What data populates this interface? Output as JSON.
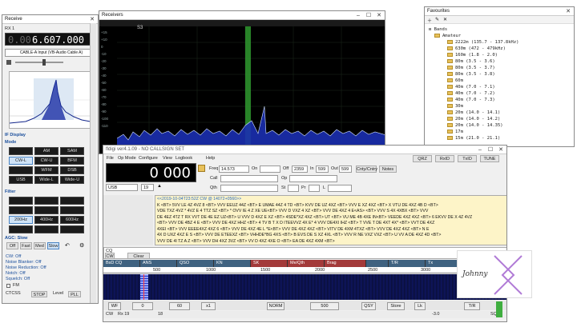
{
  "receive": {
    "title": "Receive",
    "rx_label": "RX 1",
    "freq_prefix": "0.00",
    "freq_main": "6.607.000",
    "audio_input": "CABLE-A Input (VB-Audio Cable A)",
    "display_label": "IF Display",
    "mode_label": "Mode",
    "modes": [
      "",
      "AM",
      "SAM",
      "CW-L",
      "CW-U",
      "BFM",
      "",
      "WFM",
      "DSB",
      "USB",
      "Wide-L",
      "Wide-U"
    ],
    "filter_label": "Filter",
    "filters": [
      "",
      "",
      "",
      "",
      "",
      "",
      "200Hz",
      "400Hz",
      "600Hz",
      "",
      "",
      ""
    ],
    "agc_label": "AGC: Slow",
    "agc_buttons": [
      "Off",
      "Fast",
      "Med",
      "Slow"
    ],
    "options": [
      "CW: Off",
      "Noise Blanker: Off",
      "Noise Reduction: Off",
      "Notch: Off",
      "Squelch: Off"
    ],
    "fm_label": "FM",
    "ctcss_label": "CTCSS",
    "level_label": "Level",
    "stop_label": "STOP",
    "pll_label": "PLL"
  },
  "receivers": {
    "title": "Receivers",
    "channel": "S3",
    "db_ticks": [
      "+15",
      "+10",
      "0",
      "-10",
      "-20",
      "-30",
      "-40",
      "-50",
      "-60",
      "-70",
      "-80",
      "-90",
      "-100",
      "-110"
    ]
  },
  "favourites": {
    "title": "Favourites",
    "root": "Bands",
    "group": "Amateur",
    "items": [
      "2222m (135.7 - 137.8kHz)",
      "630m (472 - 479kHz)",
      "160m (1.8 - 2.0)",
      "80m (3.5 - 3.6)",
      "80m (3.5 - 3.7)",
      "80m (3.5 - 3.8)",
      "60m",
      "40m (7.0 - 7.1)",
      "40m (7.0 - 7.2)",
      "40m (7.0 - 7.3)",
      "30m",
      "20m (14.0 - 14.1)",
      "20m (14.0 - 14.2)",
      "20m (14.0 - 14.35)",
      "17m",
      "15m (21.0 - 21.1)"
    ]
  },
  "hdsdr": {
    "title": "fldigi ver4.1.09 - NO CALLSIGN SET",
    "menu": [
      "File",
      "Op Mode",
      "Configure",
      "View",
      "Logbook",
      "",
      "",
      "Help"
    ],
    "freq_display": "0 000",
    "freq_label": "Freq",
    "freq_value": "14.573",
    "on_label": "On",
    "off_label": "Off",
    "off_value": "2359",
    "in_label": "In",
    "in_value": "599",
    "out_label": "Out",
    "out_value": "599",
    "cnty_label": "Cnty/Cntry",
    "notes_label": "Notes",
    "call_label": "Call",
    "qth_label": "Qth",
    "op_label": "Op",
    "st_label": "St",
    "pr_label": "Pr",
    "loc_label": "L",
    "mode_value": "USB",
    "bw_value": "19",
    "right_buttons": [
      "QRZ",
      "RxID",
      "TxID",
      "TUNE"
    ],
    "rx_header": "<<2019-10-04T23:52Z CW @ 14072+0560>>",
    "rx_lines": [
      "K <BT> 5VV LE 4Z 4VZ 8 <BT> VVV EEUZ 44Z <BT> E UMAE 44Z 4 TD <BT> KVV DE UZ 4XZ <BT> VVV E XZ 4XZ <BT> X VTU DE 4XZ 4B D <BT>",
      "VDE TXZ 4VZ * 4VZ E 4 TTZ SZ <BT> * OVV IE 4 Z XE UE<BT> VVV D VXZ 4 XZ <BT> VVV DE 4XZ 4 E<AS> <BT> VVV S 4X 4XBX <BT> VVV",
      "DE 4EZ 4TZ T RX VVT DE 4E EZ UZ<BT> U VVV D 4XZ E XZ <BT> 4SDE*XZ 4XZ <BT> UT <BT> VU ME 4B 4XE IN<BT> VEEDE 4XZ 4XZ <BT> 6 EKVV DE X 4Z 4VZ",
      "<BT> VVV DE 4BZ 4 E <BT> VVV DE 4XZ HHZ <BT> 4 TV B T X D ITEEVVZ 4X E* 4 VVV DE4XI IHZ <BT> T VVE T DE 4XT 4X* <BT> VVT DE 4XZ",
      "4XEI <BT> VVV EEEE4XZ 4XZ 6 <BT> VVV DE 4XZ 4E L *E<BT> VVV DE 4XZ 4XZ <BT> VITV DE 4XM 4TXZ <BT> VVV DE 4XZ 4XZ <BT> N E",
      "4X D UXZ 4XZ E S <BT> VVV DE ETEEXZ <BT> VHHDE*BG 4XS <BT> B EVS DE S XZ 4XL <BT> VVV R NE VXZ VXZ <BT> U VV A DE 4XZ 4D <BT>",
      "VVV DE 4I TZ A Z <BT> VVV DH 4XZ 3VZ <BT> VV D 4XZ 4XE O <BT> EA DE 4XZ 4XM <BT>"
    ],
    "tx_label": "CQ",
    "clear_label": "Clear",
    "mode_button": "CW",
    "macros": [
      "BsD CQ",
      "ANS",
      "QSO",
      "KN",
      "SK",
      "Me/Qth",
      "Brag",
      "",
      "T/R",
      "Tx",
      "Rx"
    ],
    "scale_ticks": [
      "500",
      "1000",
      "1500",
      "2000",
      "2500",
      "3000"
    ],
    "bottom_controls": [
      "WF",
      "0",
      "60",
      "x1",
      "NORM",
      "500",
      "QSY",
      "Store",
      "Lk",
      "T/R"
    ],
    "status": [
      "CW",
      "Rx 19",
      "18",
      "-3.0",
      "SQL"
    ]
  },
  "watermark": {
    "text": "Johnny",
    "accent": "#b07ad6"
  },
  "colors": {
    "spectrum_bg": "#000000",
    "waterfall_blue": "#1a2ea8",
    "signal_green": "#3fae3f",
    "rx_pane": "#fdf4c8",
    "macro_bg": "#3f6280",
    "macro_red": "#a33a3a"
  }
}
